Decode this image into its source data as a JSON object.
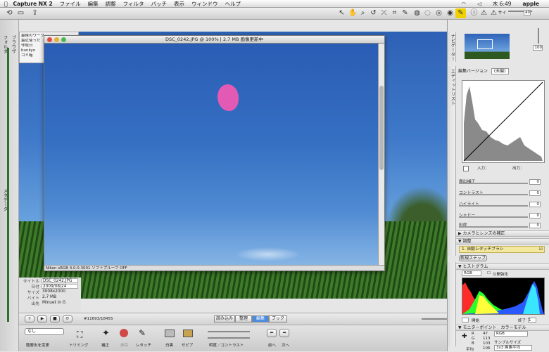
{
  "menubar": {
    "apple": "",
    "app": "Capture NX 2",
    "items": [
      "ファイル",
      "編集",
      "調整",
      "フィルタ",
      "バッチ",
      "表示",
      "ウィンドウ",
      "ヘルプ"
    ],
    "clock": "木 6:49",
    "user": "apple"
  },
  "left_tabs": {
    "browser": "ブラウザ",
    "metadata": "メタデータ",
    "folder": "フォルダ"
  },
  "file_tree": [
    "最後のワーク",
    "最近使った",
    "作成日",
    "bunkyo",
    "ゴミ箱"
  ],
  "window": {
    "title": "DSC_0242.JPG @ 100% | 2.7 MB 画像更新中",
    "status": "Nikon sRGB 4.0.0.3001  ソフトプルーフ OFF"
  },
  "metadata": {
    "rows": [
      {
        "key": "タイトル",
        "value": "DSC_0242.JPG"
      },
      {
        "key": "日付",
        "value": "2009/08/24"
      },
      {
        "key": "サイズ",
        "value": "3008x2000"
      },
      {
        "key": "バイト",
        "value": "2.7 MB"
      },
      {
        "key": "出先",
        "value": "Minuet in G"
      }
    ]
  },
  "navrow": {
    "counter": "#11693/18455",
    "tabs": [
      "読み込み",
      "整理",
      "編集",
      "ブック"
    ],
    "active_tab": "編集"
  },
  "bottom": {
    "preset": "なし",
    "preset_btn": "階層出を変更",
    "trim": "トリミング",
    "fix": "補正",
    "redeye": "赤目",
    "retouch": "レタッチ",
    "bw": "白黒",
    "sepia": "セピア",
    "brightness": "明度／コントラスト",
    "prev": "前へ",
    "next": "次へ"
  },
  "right": {
    "size_label": "サイズ",
    "size_value": "40",
    "zoom_value": "100",
    "navigator_tab": "ナビゲーター",
    "edit_list_tab": "エディットリスト",
    "version_label": "編集バージョン",
    "version_value": "(未編)",
    "in_label": "入力：",
    "out_label": "出力：",
    "sliders": [
      {
        "label": "露出補正",
        "value": "0"
      },
      {
        "label": "コントラスト",
        "value": "0"
      },
      {
        "label": "ハイライト",
        "value": "0"
      },
      {
        "label": "シャドー",
        "value": "0"
      },
      {
        "label": "彩度",
        "value": "0"
      }
    ],
    "camera_lens": "カメラとレンズの補正",
    "adjust_hdr": "調整",
    "auto_retouch": "1. 自動レタッチブラシ",
    "new_step": "新規ステップ",
    "histogram_hdr": "ヒストグラム",
    "histogram_mode": "RGB",
    "histogram_check": "公開強化",
    "start_label": "開始",
    "end_label": "終了",
    "end_value": "1",
    "monitor_hdr": "モニターポイント",
    "color_model_label": "カラーモデル",
    "color_model_value": "RGB",
    "rgb": [
      {
        "ch": "R",
        "val": "47"
      },
      {
        "ch": "G",
        "val": "113"
      },
      {
        "ch": "B",
        "val": "103"
      }
    ],
    "avg_label": "平均",
    "avg_value": "106",
    "sample_label": "サンプルサイズ",
    "sample_value": "3x3 画素平均"
  },
  "colors": {
    "accent": "#3a7bd5",
    "sky": "#2e63b8",
    "pink": "#e35ab5"
  }
}
